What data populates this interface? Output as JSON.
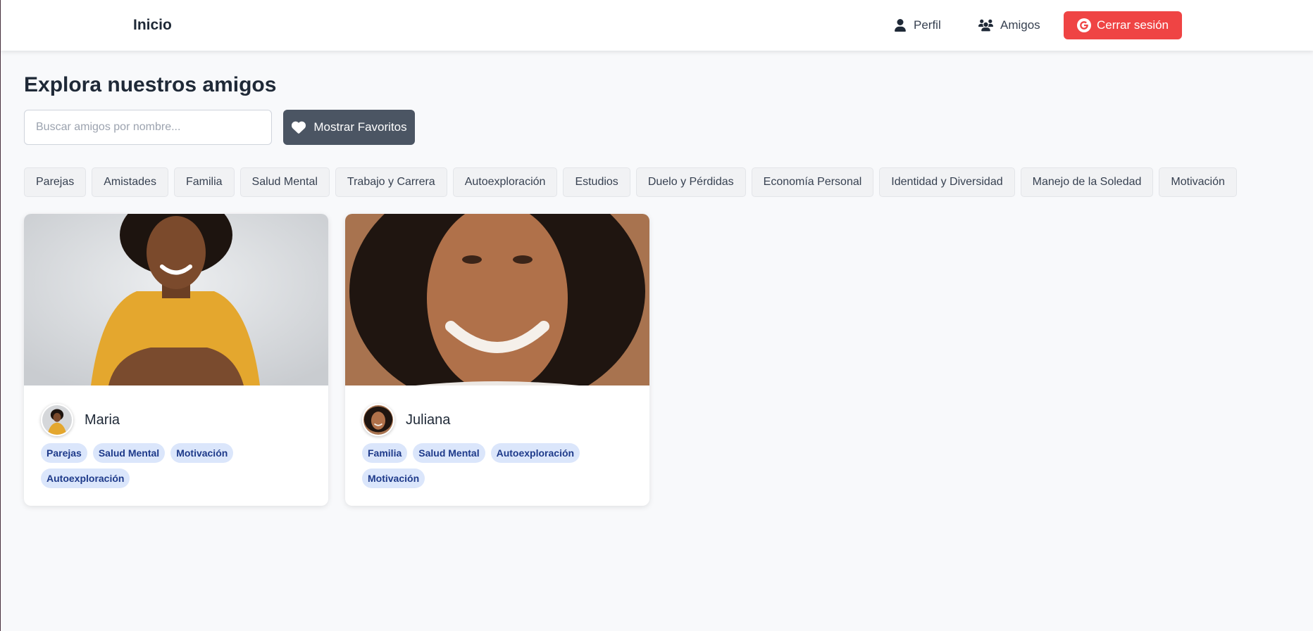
{
  "navbar": {
    "brand": "Inicio",
    "profile_label": "Perfil",
    "friends_label": "Amigos",
    "logout_label": "Cerrar sesión"
  },
  "main": {
    "title": "Explora nuestros amigos",
    "search_placeholder": "Buscar amigos por nombre...",
    "favorites_label": "Mostrar Favoritos"
  },
  "categories": [
    "Parejas",
    "Amistades",
    "Familia",
    "Salud Mental",
    "Trabajo y Carrera",
    "Autoexploración",
    "Estudios",
    "Duelo y Pérdidas",
    "Economía Personal",
    "Identidad y Diversidad",
    "Manejo de la Soledad",
    "Motivación"
  ],
  "friends": [
    {
      "name": "Maria",
      "tags": [
        "Parejas",
        "Salud Mental",
        "Motivación",
        "Autoexploración"
      ]
    },
    {
      "name": "Juliana",
      "tags": [
        "Familia",
        "Salud Mental",
        "Autoexploración",
        "Motivación"
      ]
    }
  ],
  "colors": {
    "logout": "#ef4444",
    "favorites": "#4b5563",
    "tag_bg": "#dbe6fb",
    "tag_text": "#1e3a8a"
  },
  "icons": {
    "profile": "user-icon",
    "friends": "users-icon",
    "logout": "google-icon",
    "favorites": "heart-icon"
  }
}
